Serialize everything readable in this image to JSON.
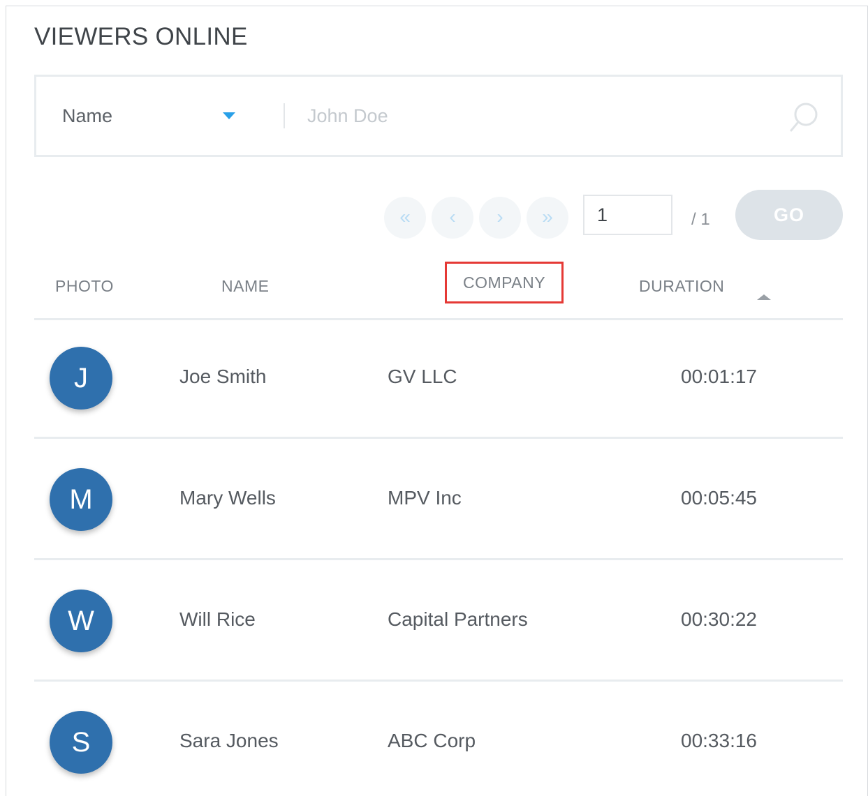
{
  "header": {
    "title": "VIEWERS ONLINE"
  },
  "search": {
    "field_label": "Name",
    "placeholder": "John Doe",
    "value": ""
  },
  "pager": {
    "first": "«",
    "prev": "‹",
    "next": "›",
    "last": "»",
    "current_page": "1",
    "total_pages": "/ 1",
    "go_label": "GO"
  },
  "table": {
    "columns": {
      "photo": "PHOTO",
      "name": "NAME",
      "company": "COMPANY",
      "duration": "DURATION"
    },
    "rows": [
      {
        "initial": "J",
        "name": "Joe Smith",
        "company": "GV LLC",
        "duration": "00:01:17"
      },
      {
        "initial": "M",
        "name": "Mary Wells",
        "company": "MPV Inc",
        "duration": "00:05:45"
      },
      {
        "initial": "W",
        "name": "Will Rice",
        "company": "Capital Partners",
        "duration": "00:30:22"
      },
      {
        "initial": "S",
        "name": "Sara Jones",
        "company": "ABC Corp",
        "duration": "00:33:16"
      }
    ]
  },
  "colors": {
    "avatar": "#2f70ad",
    "accent": "#29a0e8",
    "highlight": "#e53935"
  }
}
